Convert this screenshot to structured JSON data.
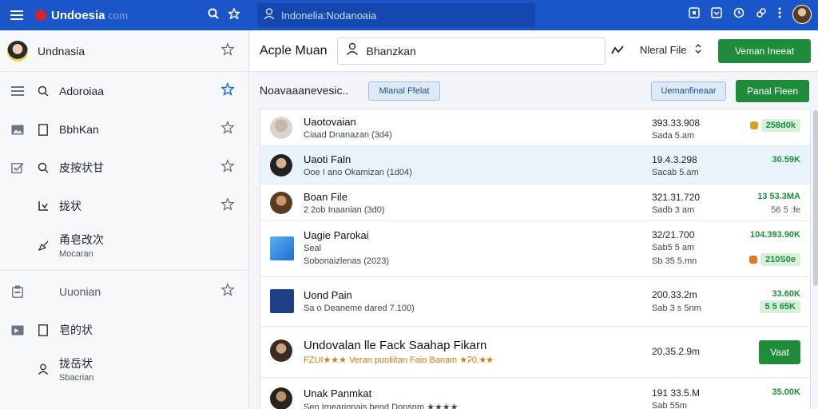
{
  "topbar": {
    "app_title": "Undoesia",
    "domain": "com",
    "search_placeholder": "Indonelia:Nodanoaia"
  },
  "sidebar": {
    "header": {
      "label": "Undnasia"
    },
    "items": [
      {
        "label": "Adoroiaa",
        "icon1": "list-icon",
        "icon2": "search-icon",
        "starred": true
      },
      {
        "label": "BbhKan",
        "icon1": "image-icon",
        "icon2": "file-icon",
        "starred": false
      },
      {
        "label": "皮按状甘",
        "icon1": "checklist-icon",
        "icon2": "search-icon",
        "starred": false
      },
      {
        "label": "拢状",
        "icon1": "",
        "icon2": "download-icon",
        "starred": false
      },
      {
        "label": "甬皂改次",
        "sub": "Mocaran",
        "icon1": "",
        "icon2": "pen-icon",
        "starred": false
      },
      {
        "label": "Uuonian",
        "icon1": "clipboard-icon",
        "icon2": "",
        "starred": false
      },
      {
        "label": "皂的状",
        "icon1": "folder-icon",
        "icon2": "file-icon",
        "starred": false
      },
      {
        "label": "拢岳状",
        "sub": "Sbacrian",
        "icon1": "",
        "icon2": "user-icon",
        "starred": false
      }
    ]
  },
  "header": {
    "title": "Acple Muan",
    "search_value": "Bhanzkan",
    "select_label": "Nleral File",
    "button_label": "Veman Ineeat"
  },
  "toolbar": {
    "label": "Noavaaanevesic..",
    "chip1": "Mlanal Ffelat",
    "chip2": "Uemanfineaar",
    "button": "Panal Fleen"
  },
  "rows": [
    {
      "name": "Uaotovaian",
      "meta": "Ciaad Dnanazan (3d4)",
      "date": "393.33.908",
      "sub": "Sada 5.am",
      "size": "258d0k",
      "size_style": "pill"
    },
    {
      "name": "Uaoti Faln",
      "meta": "Ooe I ano Okamizan (1d04)",
      "date": "19.4.3.298",
      "sub": "Sacab 5.am",
      "size": "30.59K",
      "size2": "",
      "selected": true
    },
    {
      "name": "Boan File",
      "meta": "2 2ob Inaanian (3d0)",
      "date": "321.31.720",
      "sub": "Sadb 3 am",
      "size": "13 53.3MA",
      "size2": "56 5 :fe"
    },
    {
      "name": "Uagie Parokai",
      "meta2": "Seal",
      "meta": "Sobonaizlenas (2023)",
      "date": "32/21.700",
      "sub": "Sab5 5 am",
      "sub2": "Sb 35 5.mn",
      "size": "104.393.90K",
      "size2": "210S0e"
    },
    {
      "name": "Uond Pain",
      "meta": "Sa o Deaneme dared 7.100)",
      "date": "200.33.2m",
      "sub": "Sab 3 s 5nm",
      "size": "33.60K",
      "size2": "5 5 65K"
    },
    {
      "name": "Undovalan lle Fack Saahap Fikarn",
      "meta": "FZUI★★★ Veran puoliitan Faio Banam ★Ꭾ0.★★",
      "date": "20,35.2.9m",
      "button": "Vaat"
    },
    {
      "name": "Unak Panmkat",
      "meta": "Sen Imearinnais bend Donsnm ★★★★",
      "date": "191 33.5.M",
      "sub": "Sab 55m",
      "size": "35.00K"
    }
  ],
  "colors": {
    "topbar": "#1a56c7",
    "accent_green": "#1e8c3a",
    "chip_blue": "#dde9f7"
  }
}
